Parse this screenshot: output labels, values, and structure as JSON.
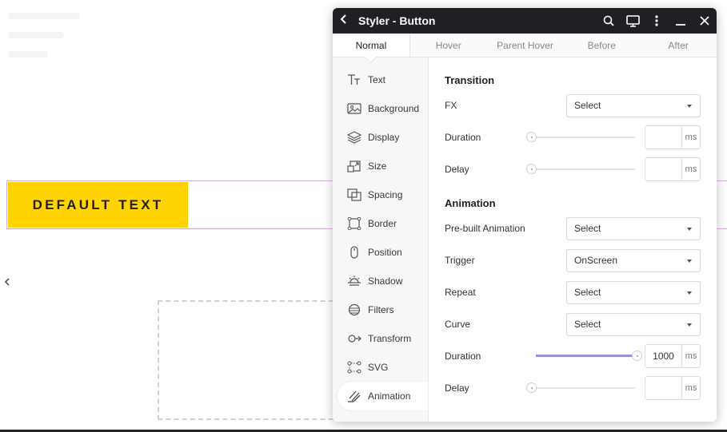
{
  "canvas": {
    "button_text": "DEFAULT TEXT"
  },
  "panel": {
    "title": "Styler - Button",
    "icons": {
      "back": "chevron-left-icon",
      "search": "search-icon",
      "device": "monitor-icon",
      "more": "kebab-menu-icon",
      "minimize": "minimize-icon",
      "close": "close-icon"
    },
    "tabs": [
      {
        "label": "Normal",
        "active": true
      },
      {
        "label": "Hover",
        "active": false
      },
      {
        "label": "Parent Hover",
        "active": false
      },
      {
        "label": "Before",
        "active": false
      },
      {
        "label": "After",
        "active": false
      }
    ],
    "sidebar": [
      {
        "label": "Text",
        "icon": "text-icon"
      },
      {
        "label": "Background",
        "icon": "image-icon"
      },
      {
        "label": "Display",
        "icon": "layers-icon"
      },
      {
        "label": "Size",
        "icon": "size-icon"
      },
      {
        "label": "Spacing",
        "icon": "spacing-icon"
      },
      {
        "label": "Border",
        "icon": "border-icon"
      },
      {
        "label": "Position",
        "icon": "mouse-icon"
      },
      {
        "label": "Shadow",
        "icon": "sunset-icon"
      },
      {
        "label": "Filters",
        "icon": "filters-icon"
      },
      {
        "label": "Transform",
        "icon": "transform-icon"
      },
      {
        "label": "SVG",
        "icon": "svg-nodes-icon"
      },
      {
        "label": "Animation",
        "icon": "animation-icon",
        "active": true
      }
    ],
    "transition": {
      "heading": "Transition",
      "fx_label": "FX",
      "fx_value": "Select",
      "duration_label": "Duration",
      "duration_value": "",
      "duration_unit": "ms",
      "delay_label": "Delay",
      "delay_value": "",
      "delay_unit": "ms"
    },
    "animation": {
      "heading": "Animation",
      "prebuilt_label": "Pre-built Animation",
      "prebuilt_value": "Select",
      "trigger_label": "Trigger",
      "trigger_value": "OnScreen",
      "repeat_label": "Repeat",
      "repeat_value": "Select",
      "curve_label": "Curve",
      "curve_value": "Select",
      "duration_label": "Duration",
      "duration_value": "1000",
      "duration_unit": "ms",
      "delay_label": "Delay",
      "delay_value": "",
      "delay_unit": "ms"
    },
    "colors": {
      "accent": "#9b8ce0",
      "button_bg": "#ffd400",
      "titlebar": "#1f2024"
    }
  }
}
